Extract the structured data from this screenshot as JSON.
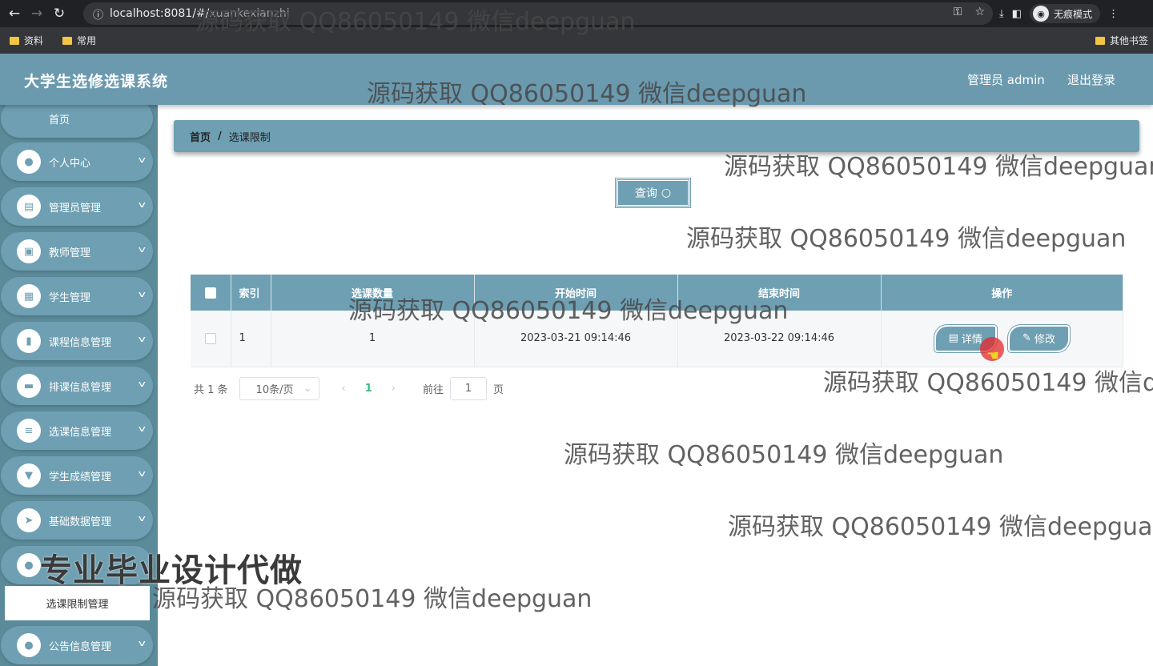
{
  "browser": {
    "url_host": "localhost:8081/#/",
    "url_path": "xuankexianzhi",
    "incognito_label": "无痕模式",
    "bookmarks": [
      "资料",
      "常用"
    ],
    "other_bookmarks": "其他书签"
  },
  "header": {
    "title": "大学生选修选课系统",
    "user": "管理员 admin",
    "logout": "退出登录"
  },
  "sidebar": {
    "home": "首页",
    "items": [
      {
        "label": "个人中心",
        "icon": "user-icon"
      },
      {
        "label": "管理员管理",
        "icon": "clipboard-icon"
      },
      {
        "label": "教师管理",
        "icon": "badge-icon"
      },
      {
        "label": "学生管理",
        "icon": "grid-icon"
      },
      {
        "label": "课程信息管理",
        "icon": "chart-icon"
      },
      {
        "label": "排课信息管理",
        "icon": "monitor-icon"
      },
      {
        "label": "选课信息管理",
        "icon": "sliders-icon"
      },
      {
        "label": "学生成绩管理",
        "icon": "signpost-icon"
      },
      {
        "label": "基础数据管理",
        "icon": "send-icon"
      },
      {
        "label": "",
        "icon": "bulb-icon"
      },
      {
        "label": "公告信息管理",
        "icon": "user-icon"
      }
    ],
    "active_sub": "选课限制管理"
  },
  "breadcrumb": {
    "home": "首页",
    "sep": "/",
    "current": "选课限制"
  },
  "toolbar": {
    "query_label": "查询"
  },
  "table": {
    "columns": [
      "索引",
      "选课数量",
      "开始时间",
      "结束时间",
      "操作"
    ],
    "rows": [
      {
        "index": "1",
        "count": "1",
        "start": "2023-03-21 09:14:46",
        "end": "2023-03-22 09:14:46"
      }
    ],
    "detail_label": "详情",
    "edit_label": "修改"
  },
  "pager": {
    "total": "共 1 条",
    "page_size": "10条/页",
    "current": "1",
    "goto_prefix": "前往",
    "goto_value": "1",
    "goto_suffix": "页"
  },
  "overlay": {
    "watermark": "源码获取 QQ86050149 微信deepguan",
    "watermark_cut": "源码获取 QQ86050149 微信de",
    "banner": "专业毕业设计代做"
  }
}
